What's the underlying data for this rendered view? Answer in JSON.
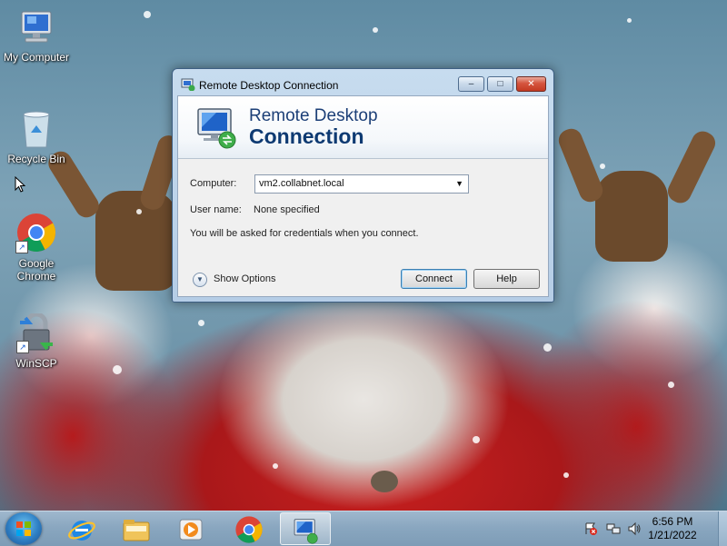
{
  "desktop": {
    "icons": [
      {
        "label": "My Computer",
        "icon": "computer-icon"
      },
      {
        "label": "Recycle Bin",
        "icon": "recycle-bin-icon"
      },
      {
        "label": "Google Chrome",
        "icon": "chrome-icon"
      },
      {
        "label": "WinSCP",
        "icon": "winscp-icon"
      }
    ]
  },
  "window": {
    "title": "Remote Desktop Connection",
    "caption_buttons": {
      "minimize": "–",
      "maximize": "□",
      "close": "✕"
    },
    "banner": {
      "line1": "Remote Desktop",
      "line2": "Connection"
    },
    "computer_label": "Computer:",
    "computer_value": "vm2.collabnet.local",
    "username_label": "User name:",
    "username_value": "None specified",
    "credentials_note": "You will be asked for credentials when you connect.",
    "show_options": "Show Options",
    "connect_button": "Connect",
    "help_button": "Help"
  },
  "taskbar": {
    "pinned": [
      "internet-explorer-icon",
      "file-explorer-icon",
      "media-player-icon",
      "chrome-icon",
      "remote-desktop-icon"
    ],
    "tray": [
      "action-center-icon",
      "network-icon",
      "volume-icon"
    ],
    "time": "6:56 PM",
    "date": "1/21/2022"
  },
  "colors": {
    "accent": "#0e3a72",
    "taskbar": "#8aa7c0",
    "close_button": "#c43a22"
  }
}
